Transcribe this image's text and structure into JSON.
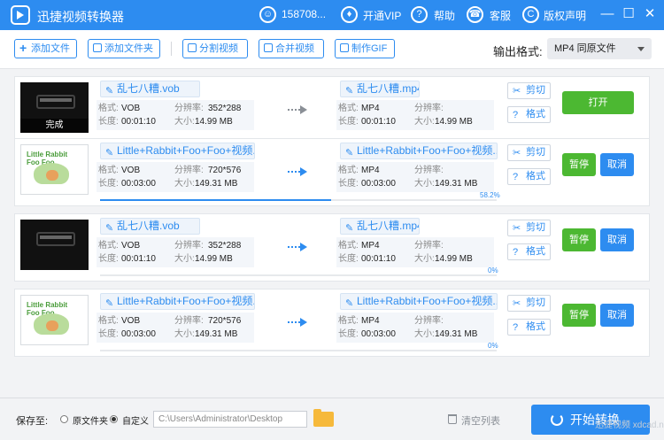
{
  "app": {
    "title": "迅捷视频转换器"
  },
  "header": {
    "user": "158708...",
    "vip": "开通VIP",
    "help": "帮助",
    "service": "客服",
    "copyright": "版权声明",
    "user_icon": "user-icon",
    "vip_icon": "vip-icon",
    "help_icon": "help-icon",
    "service_icon": "headset-icon",
    "copyright_icon": "copyright-icon"
  },
  "window": {
    "minimize": "—",
    "maximize": "☐",
    "close": "✕"
  },
  "toolbar": {
    "add_file": "添加文件",
    "add_folder": "添加文件夹",
    "split_video": "分割视频",
    "merge_video": "合并视频",
    "make_gif": "制作GIF",
    "format_label": "输出格式:",
    "format_value": "MP4  同原文件"
  },
  "labels": {
    "format": "格式:",
    "resolution": "分辨率:",
    "duration": "长度:",
    "size": "大小:",
    "cut": "剪切",
    "fmt": "格式",
    "open": "打开",
    "pause": "暂停",
    "cancel": "取消",
    "done": "完成"
  },
  "tasks": [
    {
      "source": {
        "name": "乱七八糟.vob",
        "format": "VOB",
        "resolution": "352*288",
        "duration": "00:01:10",
        "size": "14.99 MB"
      },
      "target": {
        "name": "乱七八糟.mp4",
        "format": "MP4",
        "resolution": "",
        "duration": "00:01:10",
        "size": "14.99 MB"
      },
      "state": "done",
      "progress_text": "",
      "progress": 0
    },
    {
      "source": {
        "name": "Little+Rabbit+Foo+Foo+视频...",
        "format": "VOB",
        "resolution": "720*576",
        "duration": "00:03:00",
        "size": "149.31 MB"
      },
      "target": {
        "name": "Little+Rabbit+Foo+Foo+视频...",
        "format": "MP4",
        "resolution": "",
        "duration": "00:03:00",
        "size": "149.31 MB"
      },
      "state": "converting",
      "progress_text": "58.2%",
      "progress": 0.582
    },
    {
      "source": {
        "name": "乱七八糟.vob",
        "format": "VOB",
        "resolution": "352*288",
        "duration": "00:01:10",
        "size": "14.99 MB"
      },
      "target": {
        "name": "乱七八糟.mp4",
        "format": "MP4",
        "resolution": "",
        "duration": "00:01:10",
        "size": "14.99 MB"
      },
      "state": "waiting",
      "progress_text": "0%",
      "progress": 0
    },
    {
      "source": {
        "name": "Little+Rabbit+Foo+Foo+视频...",
        "format": "VOB",
        "resolution": "720*576",
        "duration": "00:03:00",
        "size": "149.31 MB"
      },
      "target": {
        "name": "Little+Rabbit+Foo+Foo+视频...",
        "format": "MP4",
        "resolution": "",
        "duration": "00:03:00",
        "size": "149.31 MB"
      },
      "state": "waiting",
      "progress_text": "0%",
      "progress": 0
    }
  ],
  "footer": {
    "save_label": "保存至:",
    "option_source": "原文件夹",
    "option_custom": "自定义",
    "path": "C:\\Users\\Administrator\\Desktop",
    "clear_list": "清空列表",
    "start": "开始转换"
  },
  "watermark": "迅捷视频 xdcad.net",
  "colors": {
    "accent": "#2d8cf0",
    "green": "#4cb832"
  }
}
